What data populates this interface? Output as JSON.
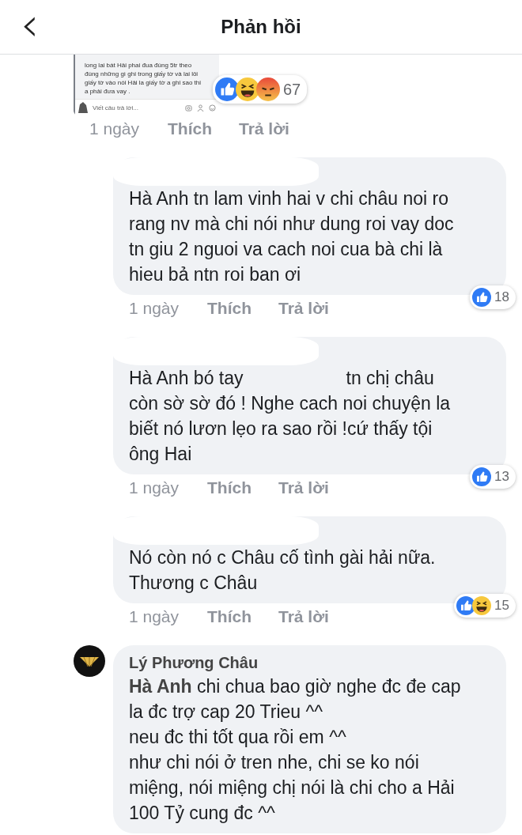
{
  "header": {
    "back": "‹",
    "title": "Phản hồi"
  },
  "shared_screenshot": {
    "lines": [
      "long lai bát Hải phai đua đúng 5tr theo",
      "đúng những gì ghi trong giấy tờ và lai lôi",
      "giấy tờ vào nói Hải la giấy tờ a ghi sao thi",
      "a phải đưa vay ."
    ],
    "reply_placeholder": "Viết câu trả lời...",
    "reactions": [
      {
        "kind": "like"
      },
      {
        "kind": "haha"
      },
      {
        "kind": "angry"
      }
    ],
    "reaction_count": "67",
    "actions": [
      "1 ngày",
      "Thích",
      "Trả lời"
    ]
  },
  "comments": [
    {
      "name_hidden": true,
      "lines": [
        [
          "Hà Anh tn lam vinh hai v chi châu noi ro"
        ],
        [
          "rang nv mà chi nói như dung roi vay doc"
        ],
        [
          "tn giu 2 nguoi va cach noi cua bà chi là"
        ],
        [
          "hieu bả ntn roi ban ơi"
        ]
      ],
      "reactions": [
        {
          "kind": "like"
        }
      ],
      "reaction_count": "18",
      "actions": [
        "1 ngày",
        "Thích",
        "Trả lời"
      ]
    },
    {
      "name_hidden": true,
      "lines": [
        [
          "Hà Anh bó tay",
          "tn chị châu"
        ],
        [
          "còn sờ sờ đó ! Nghe cach noi chuyện la"
        ],
        [
          "biết nó lươn lẹo ra sao rồi !cứ thấy tội"
        ],
        [
          "ông Hai"
        ]
      ],
      "reactions": [
        {
          "kind": "like"
        }
      ],
      "reaction_count": "13",
      "actions": [
        "1 ngày",
        "Thích",
        "Trả lời"
      ]
    },
    {
      "name_hidden": true,
      "lines": [
        [
          "Nó còn nó c Châu cố tình gài hải nữa."
        ],
        [
          "Thương c Châu"
        ]
      ],
      "reactions": [
        {
          "kind": "like"
        },
        {
          "kind": "haha"
        }
      ],
      "reaction_count": "15",
      "actions": [
        "1 ngày",
        "Thích",
        "Trả lời"
      ]
    },
    {
      "name_hidden": false,
      "author": "Lý Phương Châu",
      "lines": [
        [
          "**Hà Anh** chi chua bao giờ nghe đc đe cap"
        ],
        [
          "la đc trợ cap 20 Trieu ^^"
        ],
        [
          "neu đc thi tốt qua rồi em ^^"
        ],
        [
          "như chi nói ở tren nhe, chi se ko nói"
        ],
        [
          "miệng, nói miệng chị nói là chi cho a Hải"
        ],
        [
          "100 Tỷ cung đc ^^"
        ]
      ]
    }
  ]
}
